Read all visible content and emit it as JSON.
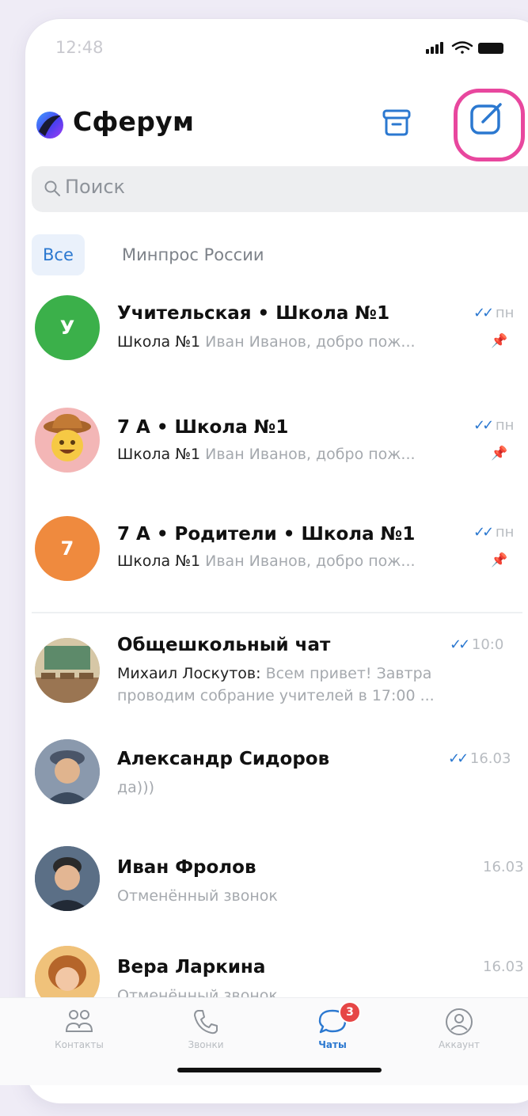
{
  "status_bar": {
    "time": "12:48"
  },
  "header": {
    "title": "Сферум",
    "archive_icon": "archive-icon",
    "compose_icon": "compose-icon"
  },
  "search": {
    "placeholder": "Поиск"
  },
  "filters": [
    {
      "label": "Все",
      "active": true
    },
    {
      "label": "Минпрос России",
      "active": false
    }
  ],
  "chats": [
    {
      "title": "Учительская • Школа №1",
      "from": "Школа №1",
      "preview": "Иван Иванов, добро пож...",
      "time": "пн",
      "read": true,
      "pinned": true,
      "avatar_letter": "У",
      "avatar_color": "#3bb04a"
    },
    {
      "title": "7 А • Школа №1",
      "from": "Школа №1",
      "preview": "Иван Иванов, добро пож...",
      "time": "пн",
      "read": true,
      "pinned": true,
      "avatar_letter": "",
      "avatar_color": "#f3b6b6"
    },
    {
      "title": "7 А • Родители • Школа №1",
      "from": "Школа №1",
      "preview": "Иван Иванов, добро пож...",
      "time": "пн",
      "read": true,
      "pinned": true,
      "avatar_letter": "7",
      "avatar_color": "#ef8a3e"
    },
    {
      "title": "Общешкольный чат",
      "from": "Михаил Лоскутов:",
      "preview": "Всем привет! Завтра",
      "preview2": "проводим собрание учителей в 17:00 ...",
      "time": "10:0",
      "read": true
    },
    {
      "title": "Александр Сидоров",
      "from": "",
      "preview": "да)))",
      "time": "16.03",
      "read": true
    },
    {
      "title": "Иван Фролов",
      "from": "",
      "preview": "Отменённый звонок",
      "time": "16.03",
      "read": false
    },
    {
      "title": "Вера Ларкина",
      "from": "",
      "preview": "Отменённый звонок",
      "time": "16.03",
      "read": false
    }
  ],
  "tabs": [
    {
      "label": "Контакты",
      "icon": "contacts-icon"
    },
    {
      "label": "Звонки",
      "icon": "phone-icon"
    },
    {
      "label": "Чаты",
      "icon": "chat-icon",
      "badge": "3",
      "active": true
    },
    {
      "label": "Аккаунт",
      "icon": "account-icon"
    }
  ],
  "colors": {
    "accent": "#2b78d0",
    "highlight_ring": "#e8479e",
    "badge": "#e64646"
  }
}
